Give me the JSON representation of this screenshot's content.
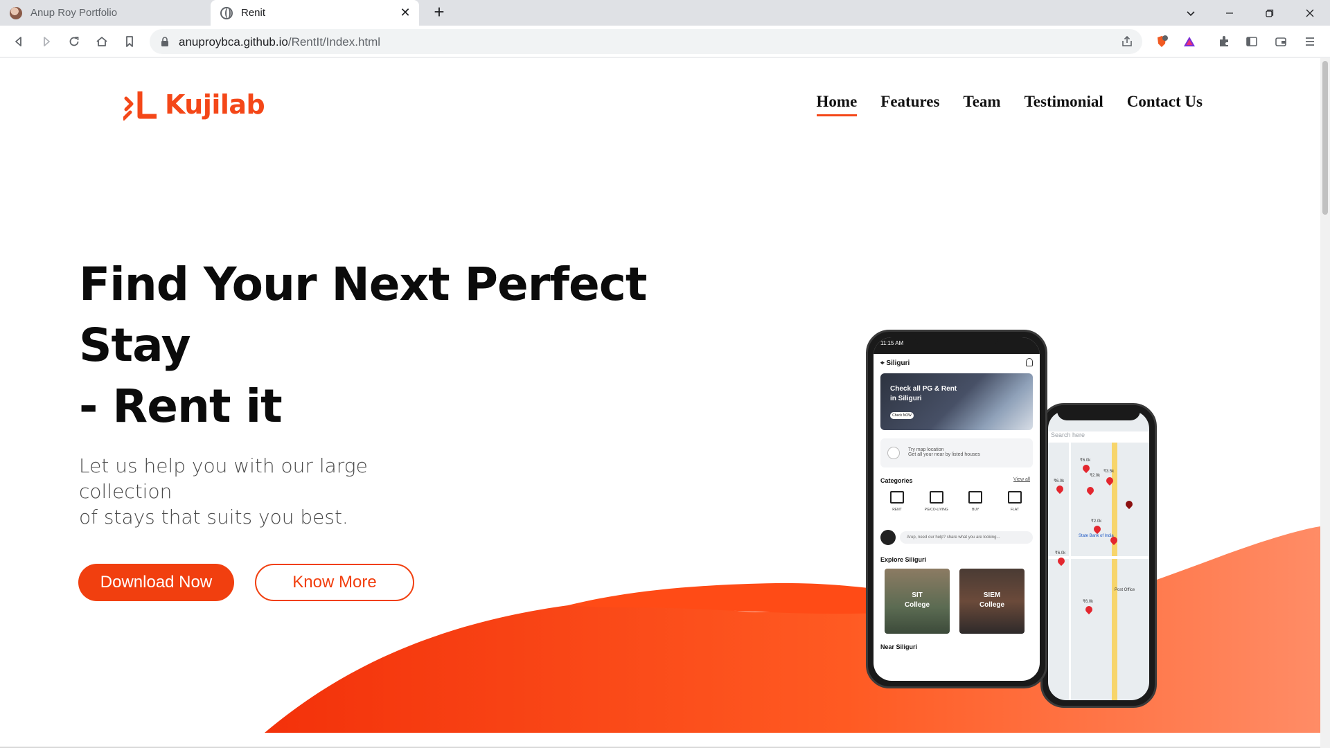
{
  "browser": {
    "tabs": [
      {
        "title": "Anup Roy Portfolio",
        "active": false
      },
      {
        "title": "Renit",
        "active": true
      }
    ],
    "url_host": "anuproybca.github.io",
    "url_path": "/RentIt/Index.html",
    "icons": [
      "back-icon",
      "forward-icon",
      "reload-icon",
      "home-icon",
      "bookmark-icon",
      "lock-icon",
      "share-icon",
      "brave-shield-icon",
      "brave-rewards-icon",
      "extensions-icon",
      "sidebar-icon",
      "wallet-icon",
      "menu-icon"
    ],
    "window_controls": [
      "tab-search",
      "minimize",
      "restore",
      "close"
    ]
  },
  "site": {
    "logo_text": "Kujilab",
    "brand_color": "#f44718",
    "nav": [
      {
        "label": "Home",
        "active": true
      },
      {
        "label": "Features",
        "active": false
      },
      {
        "label": "Team",
        "active": false
      },
      {
        "label": "Testimonial",
        "active": false
      },
      {
        "label": "Contact Us",
        "active": false
      }
    ],
    "hero": {
      "title_line1": "Find Your Next Perfect",
      "title_line2": "Stay",
      "title_line3": "- Rent it",
      "subtitle_line1": "Let us help you with our large collection",
      "subtitle_line2": "of stays that suits you best.",
      "primary_button": "Download Now",
      "secondary_button": "Know More"
    }
  },
  "phone_app": {
    "status_time": "11:15 AM",
    "city": "Siliguri",
    "banner_line1": "Check all PG & Rent",
    "banner_line2": "in Siliguri",
    "banner_button": "Check NOW",
    "map_row_title": "Try map location",
    "map_row_text": "Get all your near by listed houses",
    "categories_title": "Categories",
    "view_all": "View all",
    "categories": [
      "RENT",
      "PG/CO-LIVING",
      "BUY",
      "FLAT"
    ],
    "help_text": "Arup, need our help? share what you are looking...",
    "explore_title": "Explore Siliguri",
    "explore_cards": [
      {
        "line1": "SIT",
        "line2": "College"
      },
      {
        "line1": "SIEM",
        "line2": "College"
      }
    ],
    "near_title": "Near Siliguri",
    "map_search": "Search here",
    "map_labels": [
      "₹6.0k",
      "₹6.0k",
      "₹2.0k",
      "₹3.5k",
      "₹2.0k",
      "₹6.0k",
      "₹6.0k",
      "State Bank of India",
      "Post Office"
    ]
  }
}
